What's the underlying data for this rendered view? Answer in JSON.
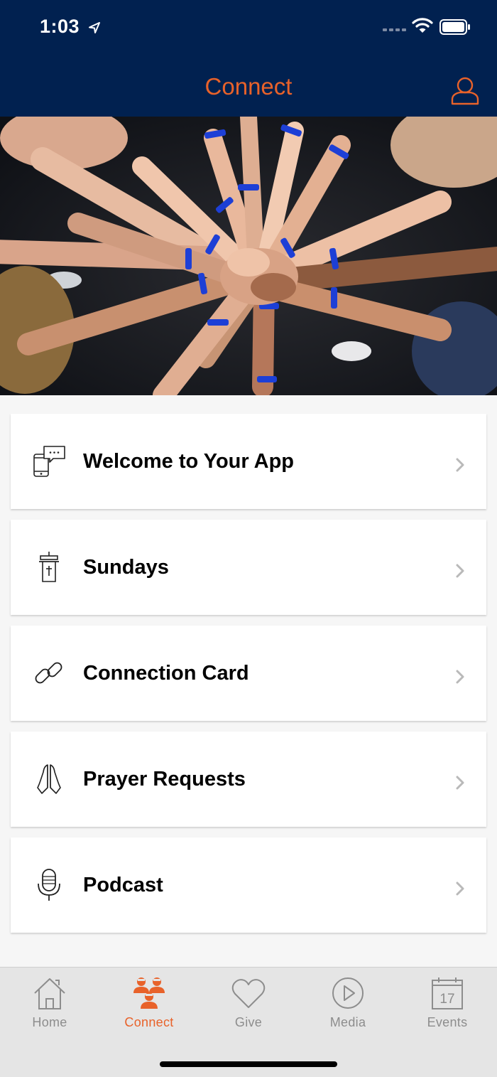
{
  "status_bar": {
    "time": "1:03"
  },
  "header": {
    "title": "Connect",
    "profile_icon": "user-outline-icon"
  },
  "hero": {
    "image": "hands-together-photo"
  },
  "menu": {
    "items": [
      {
        "label": "Welcome to Your App",
        "icon": "phone-chat-icon"
      },
      {
        "label": "Sundays",
        "icon": "pulpit-icon"
      },
      {
        "label": "Connection Card",
        "icon": "link-icon"
      },
      {
        "label": "Prayer Requests",
        "icon": "praying-hands-icon"
      },
      {
        "label": "Podcast",
        "icon": "microphone-icon"
      }
    ]
  },
  "tabbar": {
    "tabs": [
      {
        "label": "Home",
        "icon": "house-icon",
        "active": false
      },
      {
        "label": "Connect",
        "icon": "people-icon",
        "active": true
      },
      {
        "label": "Give",
        "icon": "heart-icon",
        "active": false
      },
      {
        "label": "Media",
        "icon": "play-circle-icon",
        "active": false
      },
      {
        "label": "Events",
        "icon": "calendar-icon",
        "active": false,
        "calendar_day": "17"
      }
    ]
  },
  "colors": {
    "navy": "#012150",
    "accent": "#e8622a",
    "tab_inactive": "#8d8d8d"
  }
}
